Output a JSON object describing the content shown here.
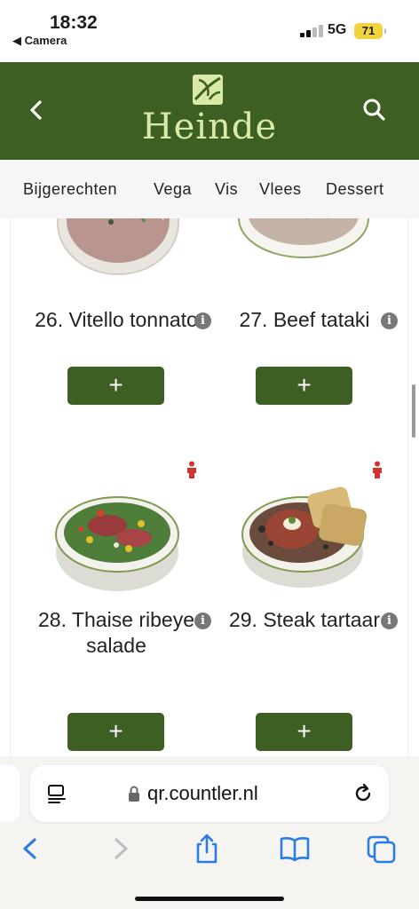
{
  "status": {
    "time": "18:32",
    "back_app": "◀ Camera",
    "network": "5G",
    "battery": "71"
  },
  "header": {
    "brand": "Heinde"
  },
  "categories": [
    "Bijgerechten",
    "Vega",
    "Vis",
    "Vlees",
    "Dessert"
  ],
  "items": [
    {
      "name": "26. Vitello tonnato",
      "add_label": "+"
    },
    {
      "name": "27. Beef tataki",
      "add_label": "+"
    },
    {
      "name": "28. Thaise ribeye salade",
      "add_label": "+"
    },
    {
      "name": "29. Steak tartaar",
      "add_label": "+"
    }
  ],
  "browser": {
    "url": "qr.countler.nl"
  },
  "colors": {
    "brand_green": "#3e5f23",
    "brand_text": "#d9e9a6",
    "accent_blue": "#2a7de1"
  }
}
